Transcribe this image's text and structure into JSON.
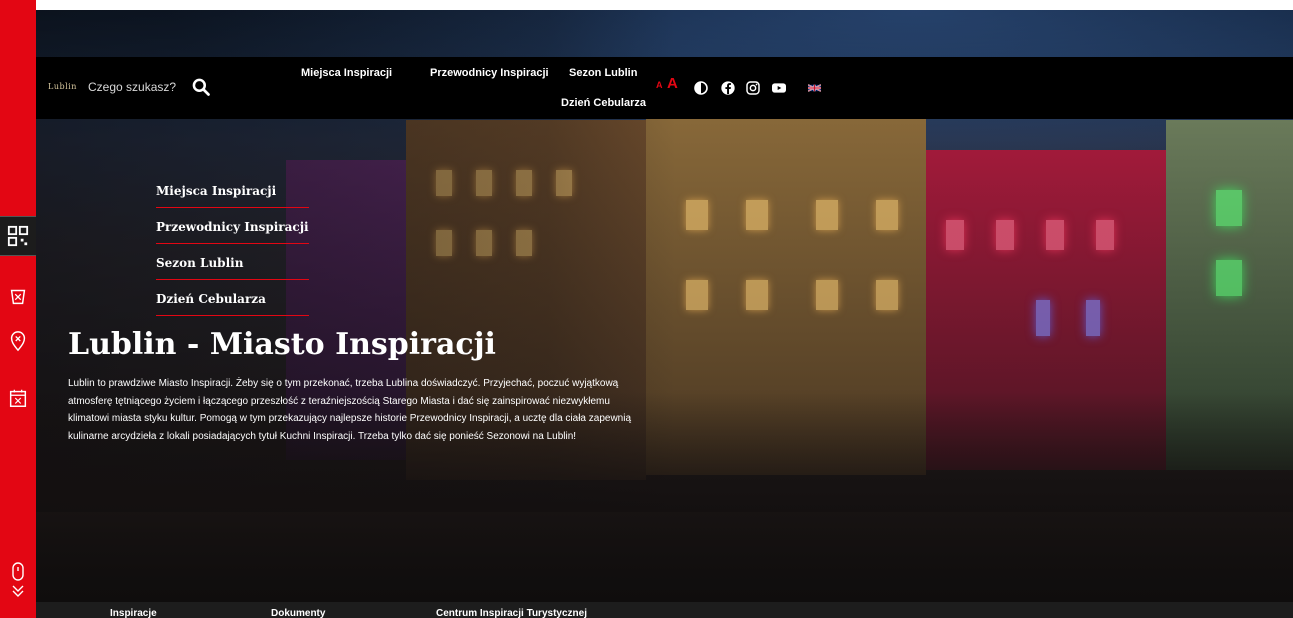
{
  "navbar": {
    "logo_text": "Lublin",
    "search_placeholder": "Czego szukasz?",
    "items": [
      {
        "label": "Miejsca Inspiracji"
      },
      {
        "label": "Przewodnicy Inspiracji"
      },
      {
        "label": "Sezon Lublin"
      },
      {
        "label": "Dzień Cebularza"
      }
    ],
    "font_size_small": "A",
    "font_size_big": "A",
    "icons": [
      "contrast-icon",
      "facebook-icon",
      "instagram-icon",
      "youtube-icon",
      "uk-flag-icon"
    ]
  },
  "side_menu": {
    "items": [
      {
        "label": "Miejsca Inspiracji"
      },
      {
        "label": "Przewodnicy Inspiracji"
      },
      {
        "label": "Sezon Lublin"
      },
      {
        "label": "Dzień Cebularza"
      }
    ]
  },
  "hero": {
    "title": "Lublin - Miasto Inspiracji",
    "description": "Lublin to prawdziwe Miasto Inspiracji. Żeby się o tym przekonać, trzeba Lublina doświadczyć. Przyjechać, poczuć wyjątkową atmosferę tętniącego życiem i łączącego przeszłość z teraźniejszością Starego Miasta i dać się zainspirować niezwykłemu klimatowi miasta styku kultur. Pomogą w tym przekazujący najlepsze historie Przewodnicy Inspiracji, a ucztę dla ciała zapewnią kulinarne arcydzieła z lokali posiadających tytuł Kuchni Inspiracji. Trzeba tylko dać się ponieść Sezonowi na Lublin!"
  },
  "rail": {
    "icons": [
      "qr-code-icon",
      "cebularz-icon",
      "map-pin-icon",
      "calendar-icon",
      "scroll-down-icon"
    ]
  },
  "footer": {
    "items": [
      {
        "label": "Inspiracje"
      },
      {
        "label": "Dokumenty"
      },
      {
        "label": "Centrum Inspiracji Turystycznej"
      }
    ]
  },
  "colors": {
    "accent": "#e30613",
    "navbar_bg": "#000000",
    "footer_bg": "#1d1d1d"
  }
}
